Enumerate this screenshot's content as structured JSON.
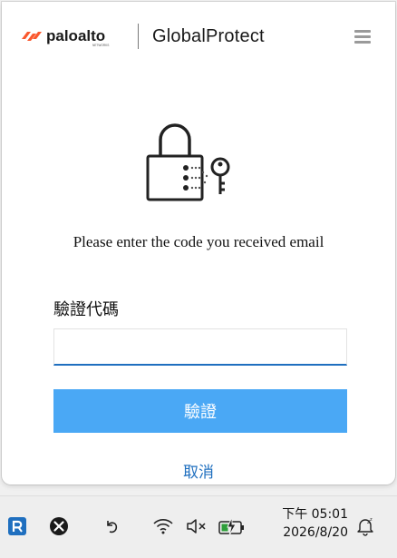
{
  "window": {
    "brand_name": "paloalto",
    "brand_tagline": "NETWORKS",
    "product_name": "GlobalProtect",
    "menu_icon": "hamburger-menu-icon",
    "illustration_icon": "lock-key-icon"
  },
  "form": {
    "instruction": "Please enter the code you received email",
    "code_label": "驗證代碼",
    "code_value": "",
    "verify_label": "驗證",
    "cancel_label": "取消"
  },
  "taskbar": {
    "icons": [
      "globalprotect-tray-icon",
      "xbox-icon",
      "undo-icon",
      "wifi-icon",
      "speaker-muted-icon",
      "battery-charging-icon",
      "notification-snooze-icon"
    ],
    "time": "下午 05:01",
    "date": "2026/8/20"
  },
  "colors": {
    "brand_orange": "#fa582d",
    "accent_blue": "#4aa8f5",
    "link_blue": "#1f6fbf",
    "input_underline": "#1f6fbf"
  }
}
